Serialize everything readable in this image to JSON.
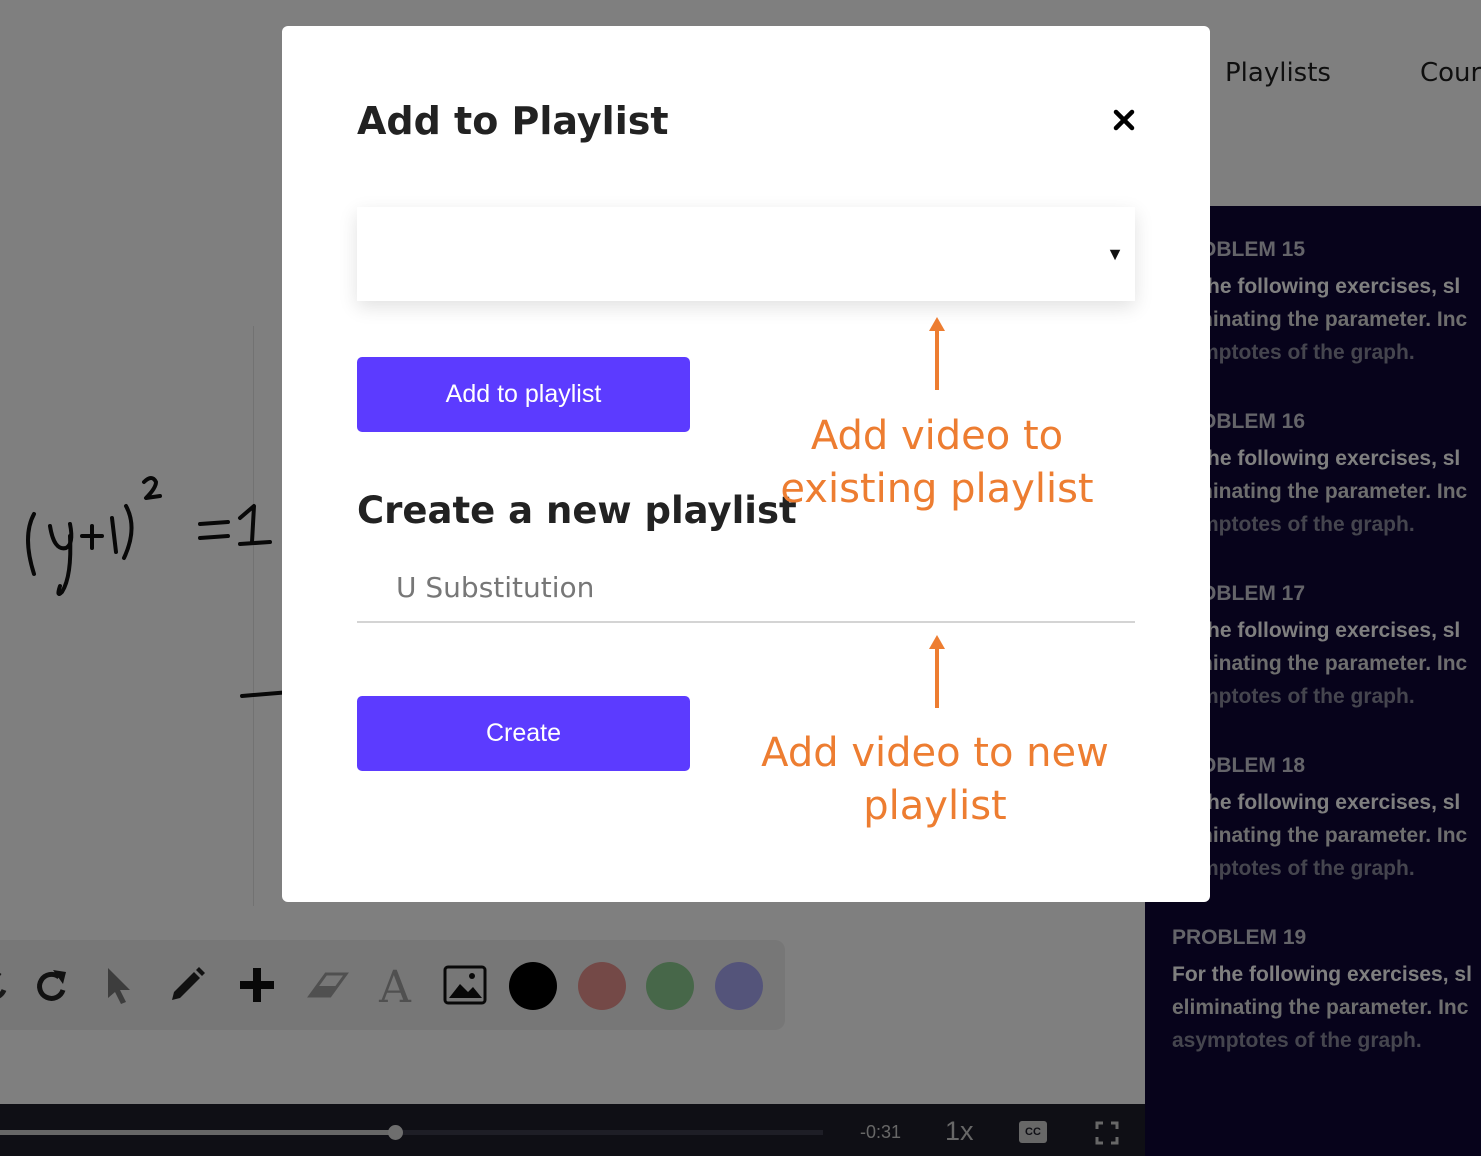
{
  "nav": {
    "playlists": "Playlists",
    "courses": "Cour"
  },
  "problems": [
    {
      "title": "OBLEM 15",
      "lines": [
        "the following exercises, sl",
        "ninating the parameter. Inc",
        "mptotes of the graph."
      ]
    },
    {
      "title": "OBLEM 16",
      "lines": [
        "the following exercises, sl",
        "ninating the parameter. Inc",
        "mptotes of the graph."
      ]
    },
    {
      "title": "OBLEM 17",
      "lines": [
        "the following exercises, sl",
        "ninating the parameter. Inc",
        "mptotes of the graph."
      ]
    },
    {
      "title": "OBLEM 18",
      "lines": [
        "the following exercises, sl",
        "ninating the parameter. Inc",
        "mptotes of the graph."
      ]
    },
    {
      "title": "PROBLEM 19",
      "lines": [
        "For the following exercises, sl",
        "eliminating the parameter. Inc",
        "asymptotes of the graph."
      ]
    }
  ],
  "handwriting": "(y+1)² = 1",
  "toolbar": {
    "tools": [
      "redo-icon",
      "pointer-icon",
      "pencil-icon",
      "plus-icon",
      "eraser-icon",
      "text-icon",
      "image-icon"
    ],
    "colors": [
      "#000000",
      "#e8928e",
      "#8fcf93",
      "#a9a8f4"
    ]
  },
  "player": {
    "time_remaining": "-0:31",
    "speed": "1x",
    "cc_label": "CC",
    "progress": 0.48
  },
  "modal": {
    "title": "Add to Playlist",
    "select_value": "",
    "select_arrow": "▼",
    "add_button": "Add to playlist",
    "create_section_title": "Create a new playlist",
    "new_playlist_placeholder": "U Substitution",
    "create_button": "Create"
  },
  "annotations": {
    "existing": [
      "Add video to",
      "existing playlist"
    ],
    "new": [
      "Add video to new",
      "playlist"
    ],
    "color": "#ed7d31"
  },
  "colors": {
    "accent": "#5c3bff",
    "panel": "#0e0636",
    "annotation": "#ed7d31"
  }
}
